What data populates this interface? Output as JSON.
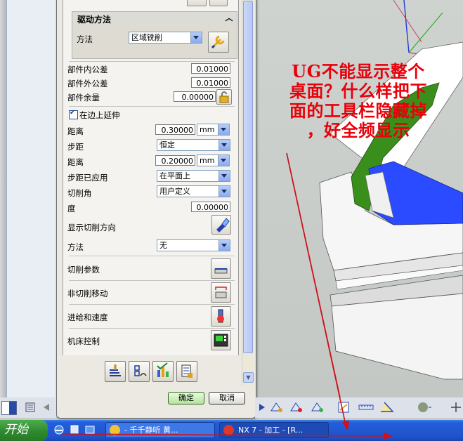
{
  "annotation": {
    "lines": [
      "UG不能显示整个",
      "桌面？什么样把下",
      "面的工具栏隐藏掉",
      "，好全频显示"
    ]
  },
  "drive_method": {
    "header": "驱动方法",
    "method_label": "方法",
    "method_value": "区域铣削"
  },
  "tolerances": [
    {
      "label": "部件内公差",
      "value": "0.01000"
    },
    {
      "label": "部件外公差",
      "value": "0.01000"
    },
    {
      "label": "部件余量",
      "value": "0.00000"
    }
  ],
  "extend": {
    "checkbox_label": "在边上延伸",
    "distance_label": "距离",
    "distance_value": "0.30000",
    "distance_unit": "mm"
  },
  "stepover": {
    "label": "步距",
    "value": "恒定",
    "distance_label": "距离",
    "distance_value": "0.20000",
    "distance_unit": "mm",
    "applied_label": "步距已应用",
    "applied_value": "在平面上"
  },
  "cut_angle": {
    "label": "切削角",
    "value": "用户定义",
    "degree_label": "度",
    "degree_value": "0.00000",
    "show_direction_label": "显示切削方向",
    "method_label": "方法",
    "method_value": "无"
  },
  "settings": [
    {
      "label": "切削参数"
    },
    {
      "label": "非切削移动"
    },
    {
      "label": "进给和速度"
    },
    {
      "label": "机床控制"
    }
  ],
  "buttons": {
    "ok": "确定",
    "cancel": "取消"
  },
  "taskbar": {
    "start": "开始",
    "tasks": [
      {
        "label": "- 千千静听   黄..."
      },
      {
        "label": "NX 7 - 加工 - [R..."
      }
    ]
  },
  "colors": {
    "annotation": "#e8000a",
    "taskbar": "#245edb",
    "start": "#3c9b3c",
    "model_green": "#3a8f1c",
    "model_blue": "#2a4bff"
  }
}
